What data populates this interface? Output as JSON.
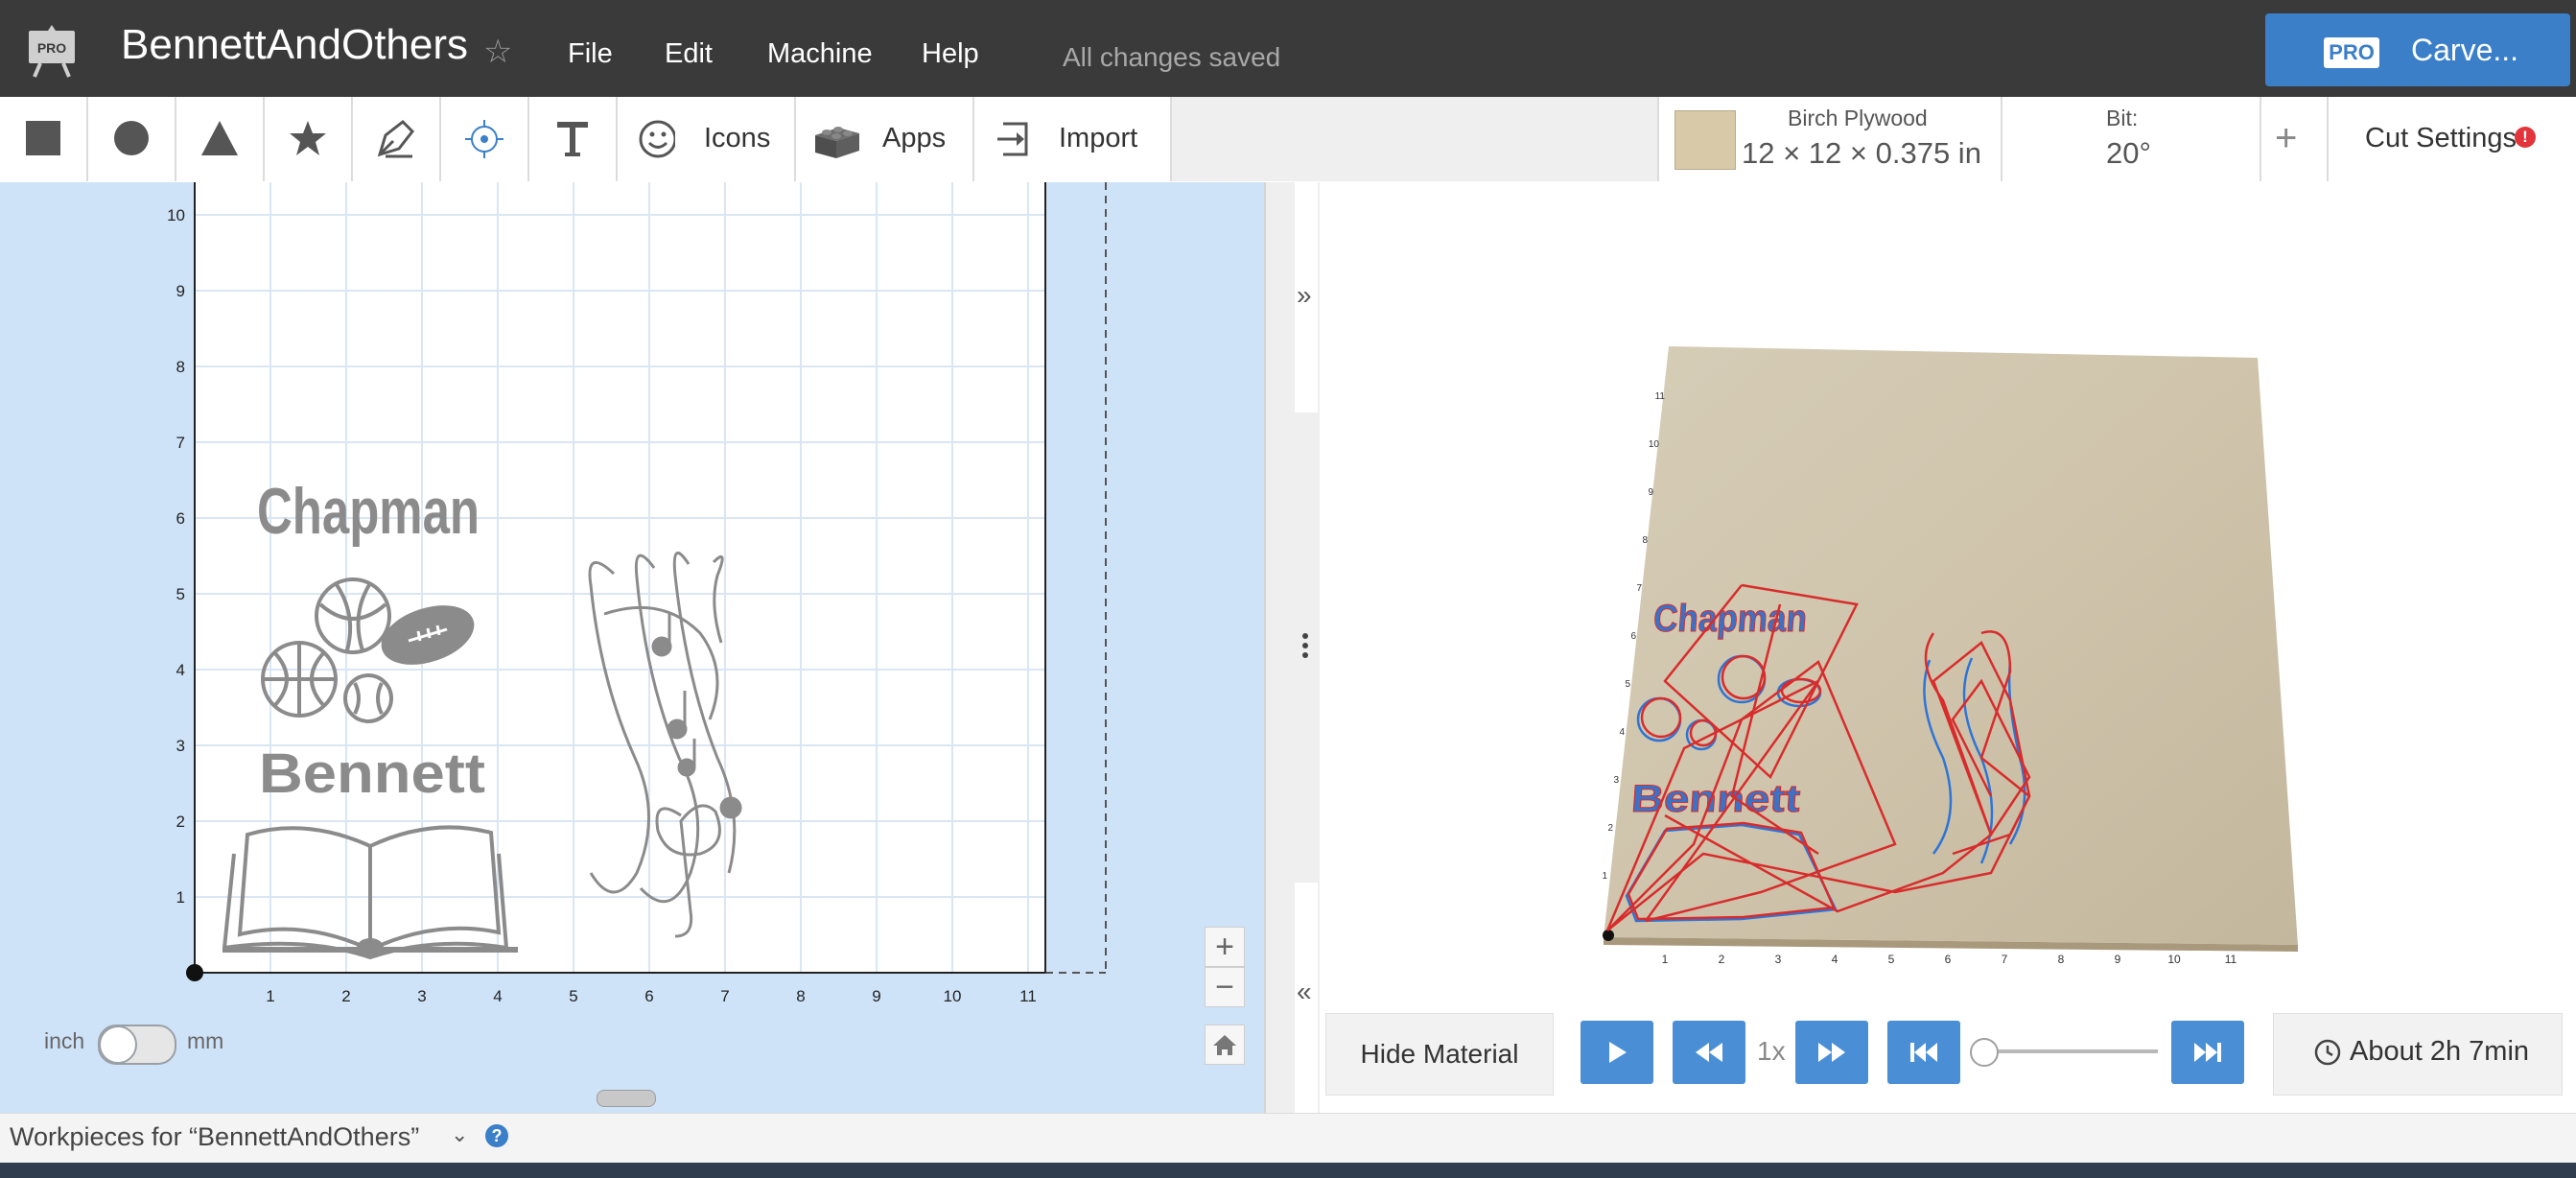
{
  "app": {
    "logo_text": "PRO",
    "project_title": "BennettAndOthers",
    "favorite_icon": "star-outline-icon",
    "menu": [
      "File",
      "Edit",
      "Machine",
      "Help"
    ],
    "save_status": "All changes saved",
    "carve": {
      "badge": "PRO",
      "label": "Carve..."
    }
  },
  "toolbar": {
    "tools": [
      {
        "name": "square-icon"
      },
      {
        "name": "circle-icon"
      },
      {
        "name": "triangle-icon"
      },
      {
        "name": "star-icon"
      },
      {
        "name": "pen-icon"
      },
      {
        "name": "point-target-icon"
      },
      {
        "name": "text-icon"
      }
    ],
    "icons_label": "Icons",
    "apps_label": "Apps",
    "import_label": "Import",
    "material": {
      "name": "Birch Plywood",
      "size": "12 × 12 × 0.375 in",
      "color": "#d8c9a8"
    },
    "bit": {
      "label": "Bit:",
      "value": "20°"
    },
    "add_icon": "+",
    "cut_settings_label": "Cut Settings",
    "warning_icon": "!"
  },
  "canvas": {
    "y_ticks": [
      "10",
      "9",
      "8",
      "7",
      "6",
      "5",
      "4",
      "3",
      "2",
      "1"
    ],
    "x_ticks": [
      "1",
      "2",
      "3",
      "4",
      "5",
      "6",
      "7",
      "8",
      "9",
      "10",
      "11"
    ],
    "texts": {
      "top_name": "Chapman",
      "bottom_name": "Bennett"
    },
    "units": {
      "left": "inch",
      "right": "mm",
      "selected": "inch"
    },
    "zoom": {
      "in": "+",
      "out": "−"
    }
  },
  "preview": {
    "ruler_x": [
      "1",
      "2",
      "3",
      "4",
      "5",
      "6",
      "7",
      "8",
      "9",
      "10",
      "11"
    ],
    "ruler_y": [
      "1",
      "2",
      "3",
      "4",
      "5",
      "6",
      "7",
      "8",
      "9",
      "10",
      "11"
    ],
    "texts": {
      "top_name": "Chapman",
      "bottom_name": "Bennett"
    },
    "hide_material_label": "Hide Material",
    "speed": "1x",
    "progress": 0,
    "time_estimate": "About 2h 7min"
  },
  "footer": {
    "workpieces_label": "Workpieces for “BennettAndOthers”",
    "help_icon": "?"
  },
  "colors": {
    "accent": "#3b7fc9",
    "canvas_bg": "#cfe3f8",
    "path_red": "#d82c2c",
    "path_blue": "#2e74d6"
  }
}
